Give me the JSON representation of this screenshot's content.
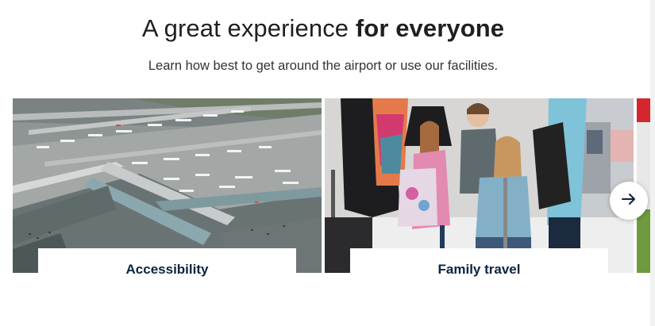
{
  "section": {
    "title_light": "A great experience ",
    "title_bold": "for everyone",
    "subtitle": "Learn how best to get around the airport or use our facilities."
  },
  "cards": [
    {
      "label": "Accessibility",
      "image": "aerial-airport-terminal-photo"
    },
    {
      "label": "Family travel",
      "image": "family-with-luggage-photo"
    },
    {
      "label": "",
      "image": "partial-next-card-photo"
    }
  ],
  "controls": {
    "next_icon": "arrow-right-icon"
  },
  "colors": {
    "label_text": "#0c2340",
    "accent_red": "#d4262e"
  }
}
